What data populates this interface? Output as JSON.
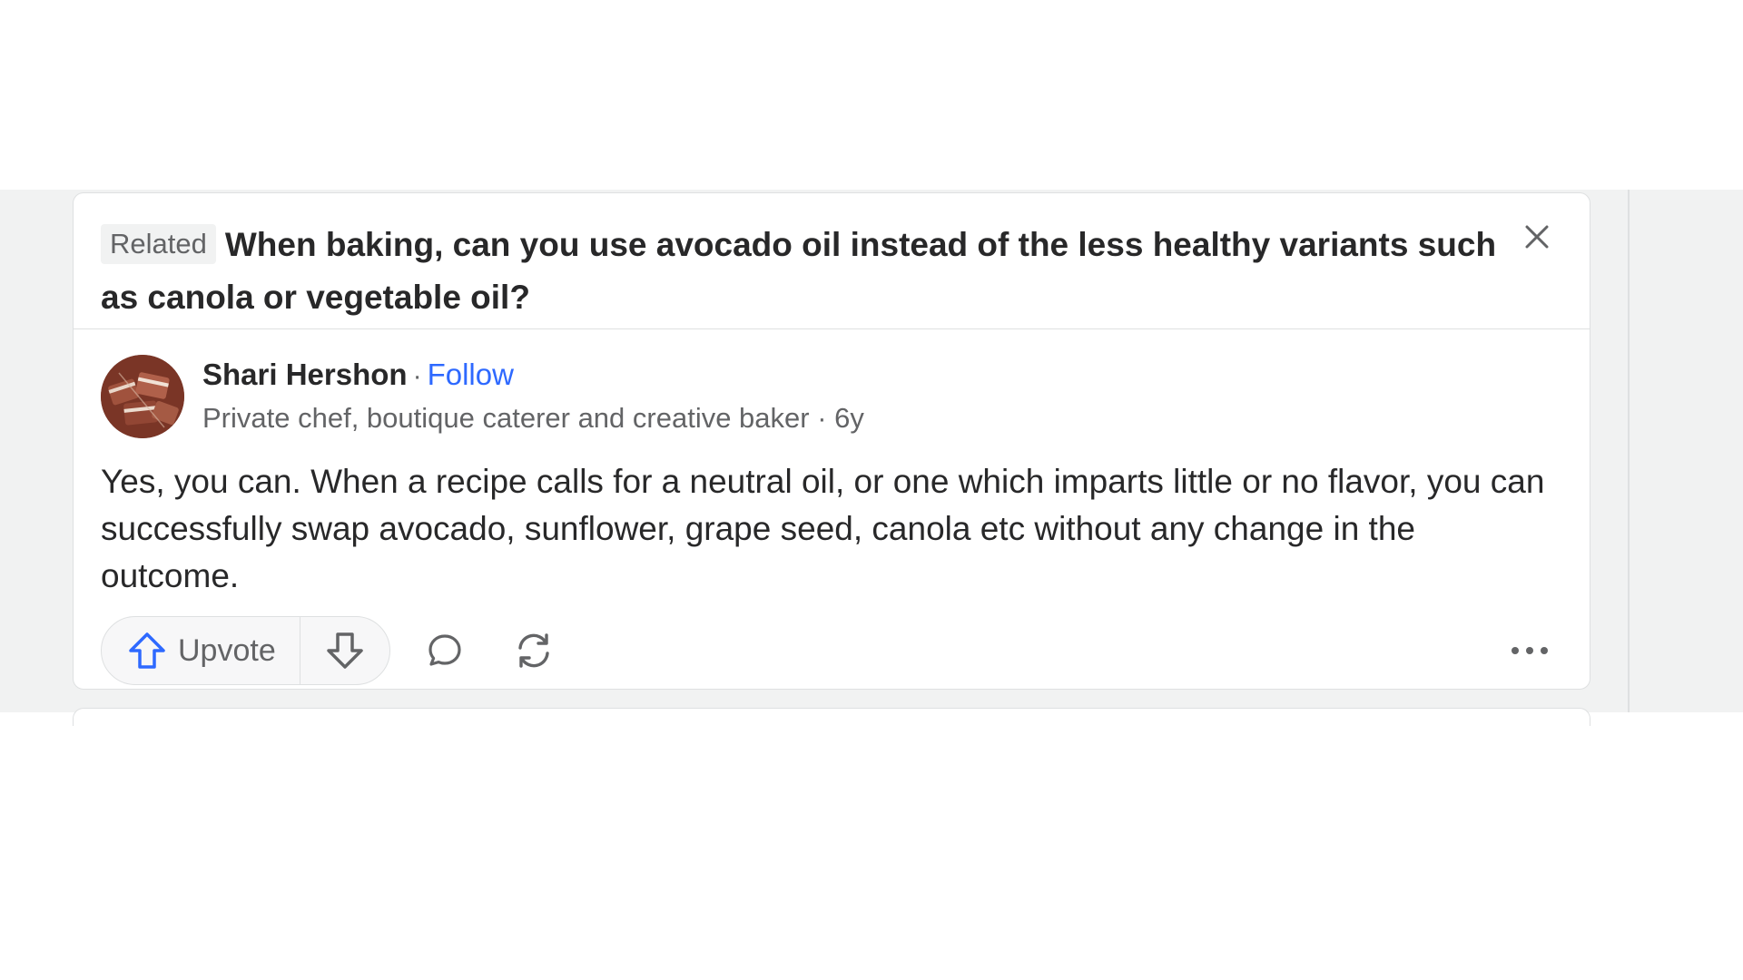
{
  "related": {
    "tag_label": "Related",
    "question": "When baking, can you use avocado oil instead of the less healthy variants such as canola or vegetable oil?"
  },
  "answer": {
    "author_name": "Shari Hershon",
    "separator": "·",
    "follow_label": "Follow",
    "credential": "Private chef, boutique caterer and creative baker · 6y",
    "text": "Yes, you can. When a recipe calls for a neutral oil, or one which imparts little or no flavor, you can successfully swap avocado, sunflower, grape seed, canola etc without any change in the outcome."
  },
  "actions": {
    "upvote_label": "Upvote"
  },
  "icons": {
    "close": "close-icon",
    "upvote": "upvote-arrow-icon",
    "downvote": "downvote-arrow-icon",
    "comment": "comment-bubble-icon",
    "share": "reshare-icon",
    "more": "more-dots-icon"
  },
  "colors": {
    "accent": "#2e69ff",
    "text": "#282829",
    "muted": "#636466",
    "border": "#dee0e1",
    "band": "#f1f2f2"
  }
}
